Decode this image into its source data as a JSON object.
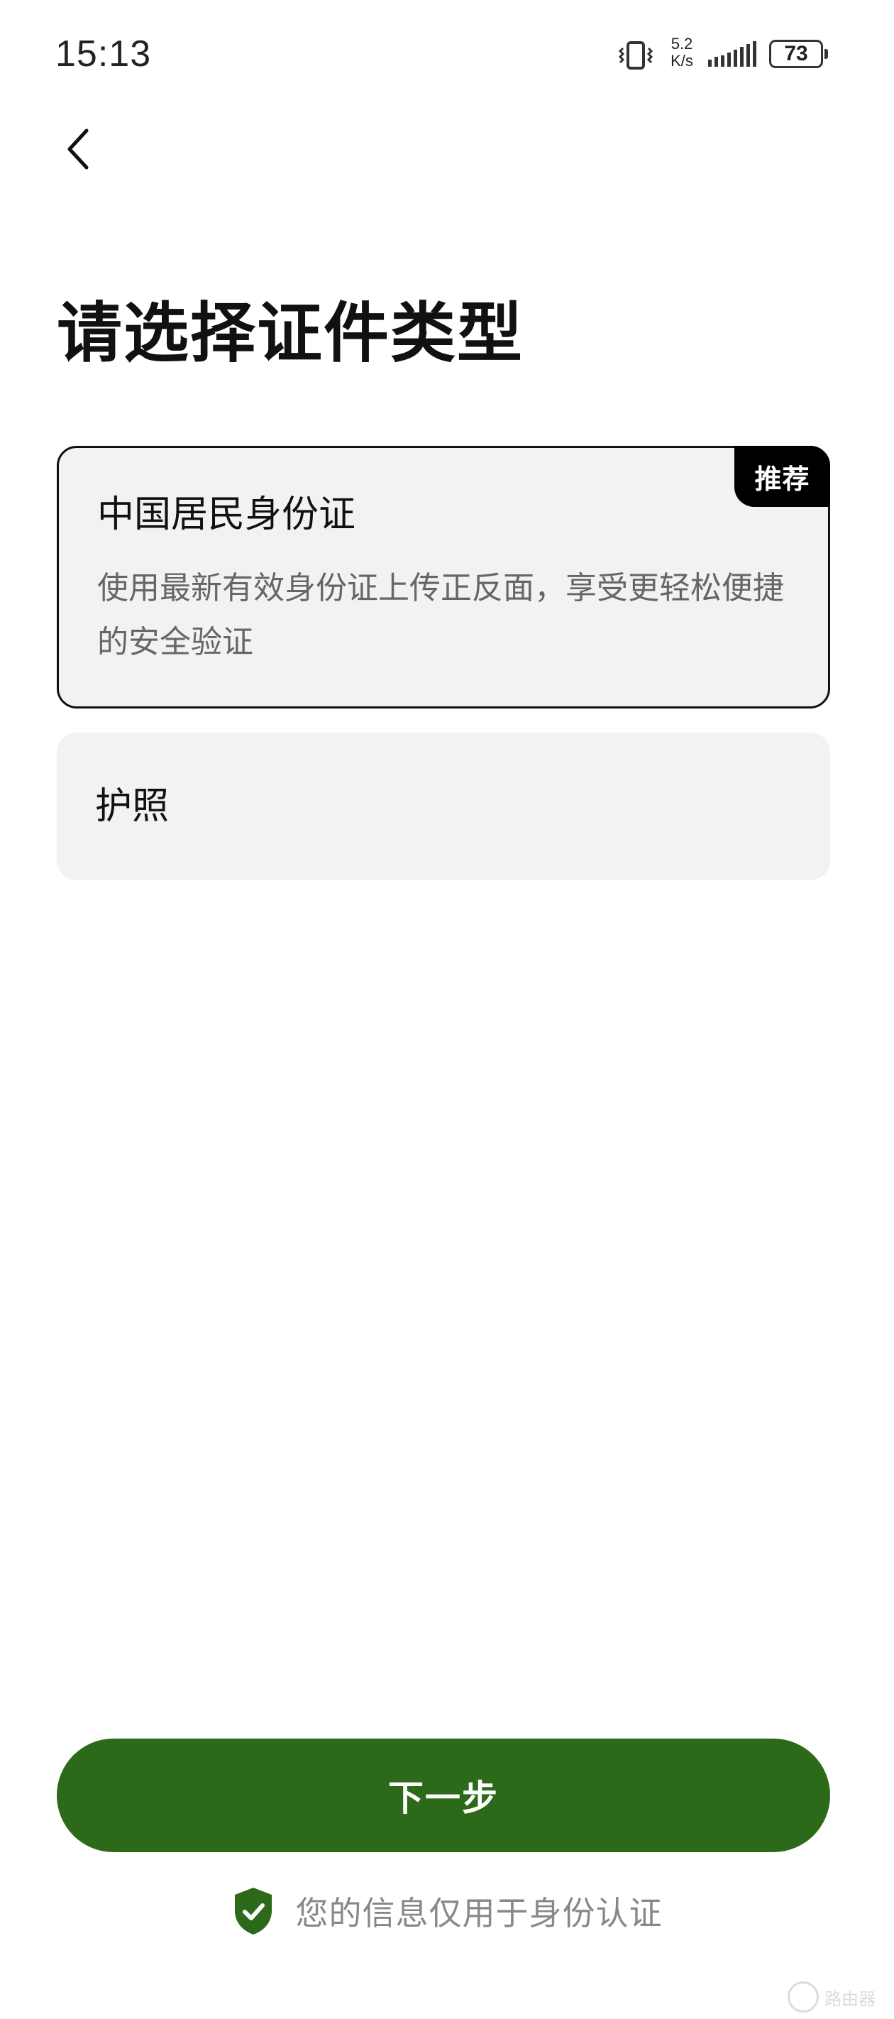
{
  "status_bar": {
    "time": "15:13",
    "net_speed_value": "5.2",
    "net_speed_unit": "K/s",
    "battery_level": "73"
  },
  "header": {
    "back_icon": "chevron-left-icon"
  },
  "page": {
    "title": "请选择证件类型"
  },
  "options": [
    {
      "title": "中国居民身份证",
      "description": "使用最新有效身份证上传正反面，享受更轻松便捷的安全验证",
      "badge": "推荐",
      "selected": true
    },
    {
      "title": "护照",
      "selected": false
    }
  ],
  "actions": {
    "next_label": "下一步"
  },
  "footer": {
    "privacy_text": "您的信息仅用于身份认证",
    "privacy_icon": "shield-check-icon"
  },
  "watermark": {
    "text": "路由器"
  },
  "colors": {
    "primary": "#2c6a1a",
    "card_background": "#f2f2f2",
    "badge_background": "#000000"
  }
}
